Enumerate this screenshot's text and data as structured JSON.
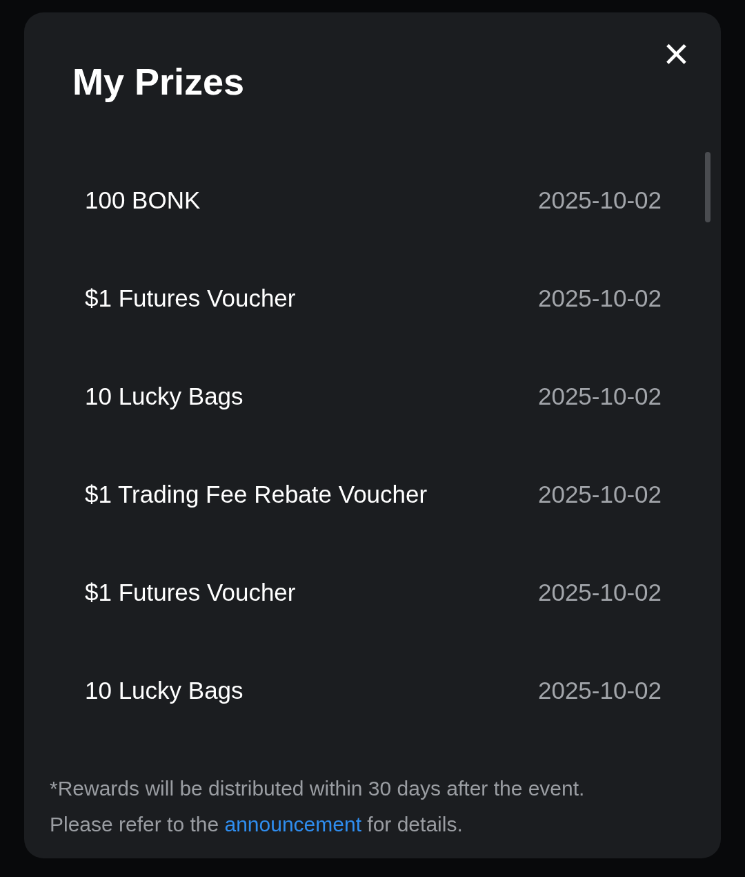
{
  "dialog": {
    "title": "My Prizes",
    "close": "×"
  },
  "prizes": [
    {
      "name": "100 BONK",
      "date": "2025-10-02"
    },
    {
      "name": "$1 Futures Voucher",
      "date": "2025-10-02"
    },
    {
      "name": "10 Lucky Bags",
      "date": "2025-10-02"
    },
    {
      "name": "$1 Trading Fee Rebate Voucher",
      "date": "2025-10-02"
    },
    {
      "name": "$1 Futures Voucher",
      "date": "2025-10-02"
    },
    {
      "name": "10 Lucky Bags",
      "date": "2025-10-02"
    }
  ],
  "note": {
    "line_1": "*Rewards will be distributed within 30 days after the event.",
    "line_2_before": "Please refer to the",
    "link": "announcement",
    "line_2_after": "for details."
  }
}
